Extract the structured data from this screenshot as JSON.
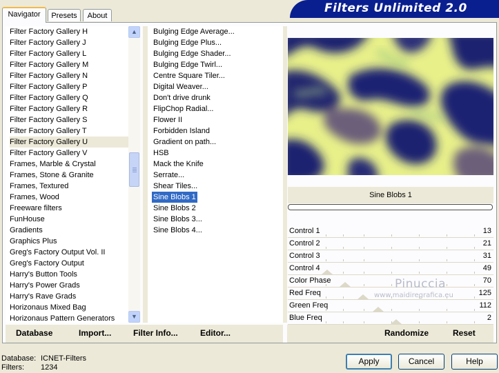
{
  "tabs": [
    {
      "label": "Navigator",
      "active": true
    },
    {
      "label": "Presets",
      "active": false
    },
    {
      "label": "About",
      "active": false
    }
  ],
  "banner_title": "Filters Unlimited 2.0",
  "categories": [
    "Filter Factory Gallery H",
    "Filter Factory Gallery J",
    "Filter Factory Gallery L",
    "Filter Factory Gallery M",
    "Filter Factory Gallery N",
    "Filter Factory Gallery P",
    "Filter Factory Gallery Q",
    "Filter Factory Gallery R",
    "Filter Factory Gallery S",
    "Filter Factory Gallery T",
    "Filter Factory Gallery U",
    "Filter Factory Gallery V",
    "Frames, Marble & Crystal",
    "Frames, Stone & Granite",
    "Frames, Textured",
    "Frames, Wood",
    "Freeware filters",
    "FunHouse",
    "Gradients",
    "Graphics Plus",
    "Greg's Factory Output Vol. II",
    "Greg's Factory Output",
    "Harry's Button Tools",
    "Harry's Power Grads",
    "Harry's Rave Grads",
    "Horizonaus Mixed Bag",
    "Horizonaus Pattern Generators"
  ],
  "selected_category": "Filter Factory Gallery U",
  "filters": [
    "Bulging Edge Average...",
    "Bulging Edge Plus...",
    "Bulging Edge Shader...",
    "Bulging Edge Twirl...",
    "Centre Square Tiler...",
    "Digital Weaver...",
    "Don't drive drunk",
    "FlipChop Radial...",
    "Flower II",
    "Forbidden Island",
    "Gradient on path...",
    "HSB",
    "Mack the Knife",
    "Serrate...",
    "Shear Tiles...",
    "Sine Blobs 1",
    "Sine Blobs 2",
    "Sine Blobs 3...",
    "Sine Blobs 4..."
  ],
  "selected_filter": "Sine Blobs 1",
  "preview_caption": "Sine Blobs 1",
  "controls": [
    {
      "label": "Control 1",
      "value": "13"
    },
    {
      "label": "Control 2",
      "value": "21"
    },
    {
      "label": "Control 3",
      "value": "31"
    },
    {
      "label": "Control 4",
      "value": "49"
    },
    {
      "label": "Color Phase",
      "value": "70"
    },
    {
      "label": "Red Freq",
      "value": "125"
    },
    {
      "label": "Green Freq",
      "value": "112"
    },
    {
      "label": "Blue Freq",
      "value": "2"
    }
  ],
  "watermark": {
    "name": "Pinuccia",
    "url": "www.maidiregrafica.eu"
  },
  "toolbar": {
    "database": "Database",
    "import": "Import...",
    "filter_info": "Filter Info...",
    "editor": "Editor...",
    "randomize": "Randomize",
    "reset": "Reset"
  },
  "status": {
    "database_label": "Database:",
    "database_value": "ICNET-Filters",
    "filters_label": "Filters:",
    "filters_value": "1234"
  },
  "buttons": {
    "apply": "Apply",
    "cancel": "Cancel",
    "help": "Help"
  },
  "colors": {
    "selection": "#316ac5",
    "banner": "#0a1f8f",
    "tab_highlight": "#f1b94a"
  }
}
